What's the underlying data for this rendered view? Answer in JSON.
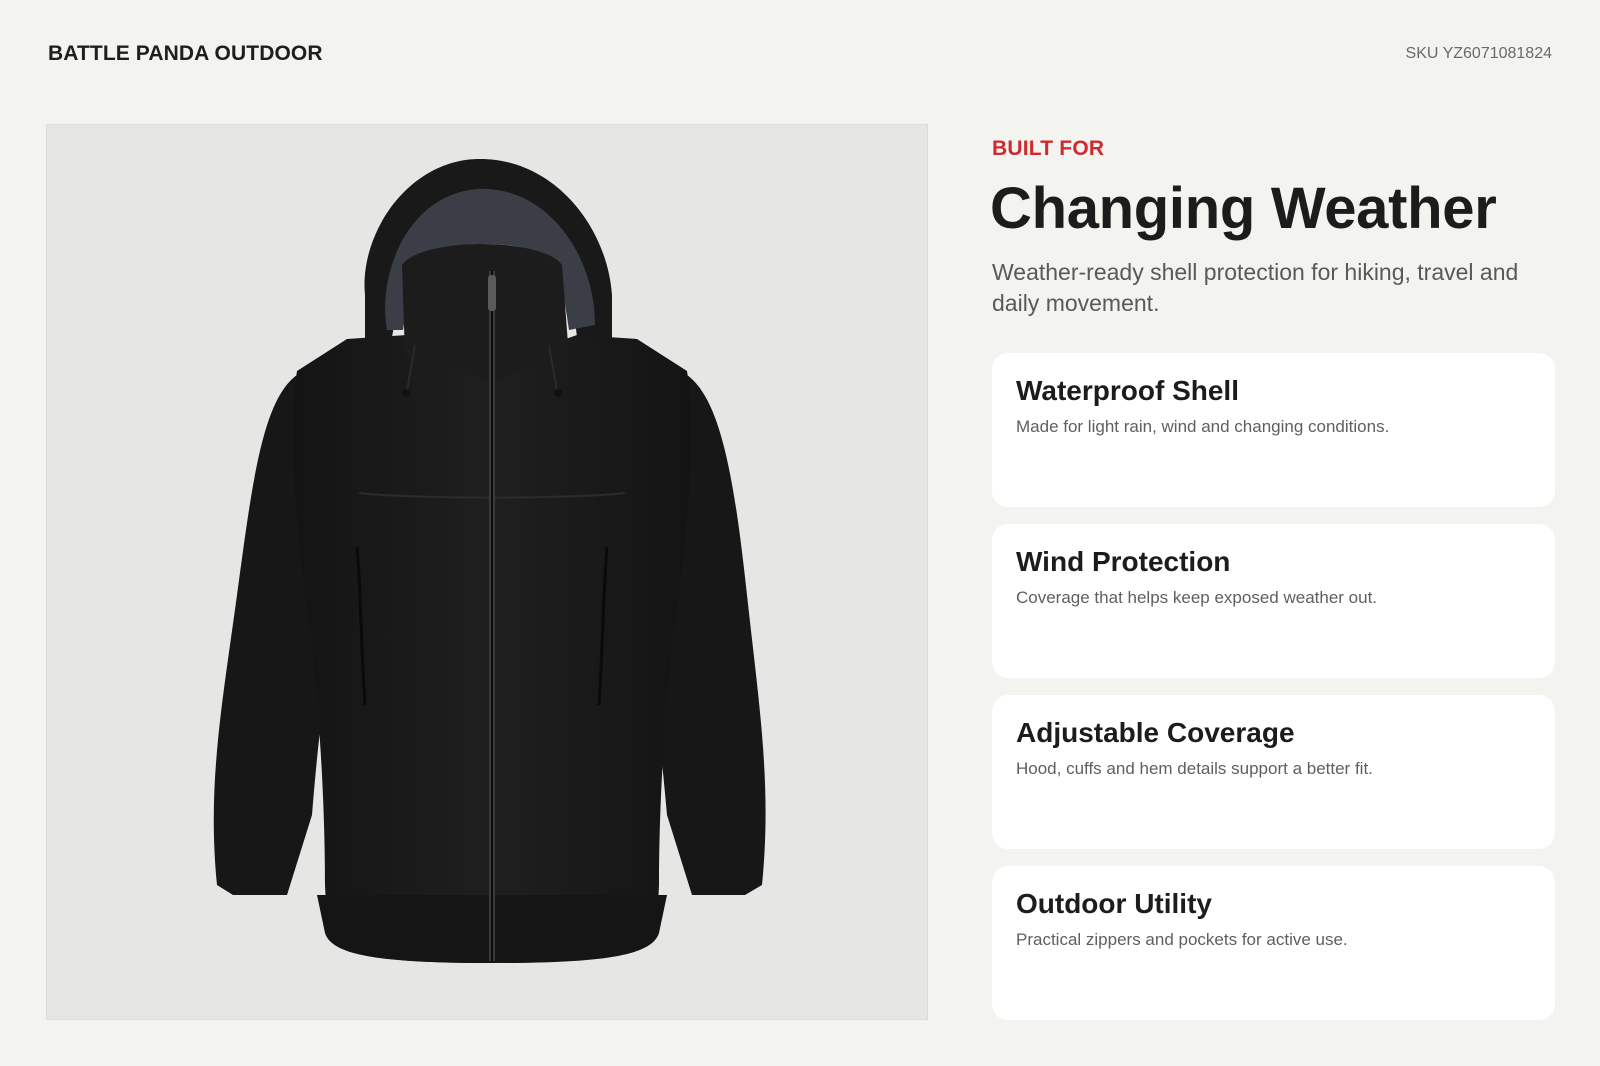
{
  "brand": "BATTLE PANDA OUTDOOR",
  "sku": "SKU YZ6071081824",
  "hero": {
    "eyebrow": "BUILT FOR",
    "headline": "Changing Weather",
    "subheadline": "Weather-ready shell protection for hiking, travel and daily movement."
  },
  "product_image": {
    "subject": "black hooded rain jacket"
  },
  "features": [
    {
      "title": "Waterproof Shell",
      "description": "Made for light rain, wind and changing conditions."
    },
    {
      "title": "Wind Protection",
      "description": "Coverage that helps keep exposed weather out."
    },
    {
      "title": "Adjustable Coverage",
      "description": "Hood, cuffs and hem details support a better fit."
    },
    {
      "title": "Outdoor Utility",
      "description": "Practical zippers and pockets for active use."
    }
  ],
  "colors": {
    "background": "#f3f3ef",
    "accent": "#cf2a2e",
    "card": "#ffffff",
    "jacket": "#1a1a1a"
  }
}
